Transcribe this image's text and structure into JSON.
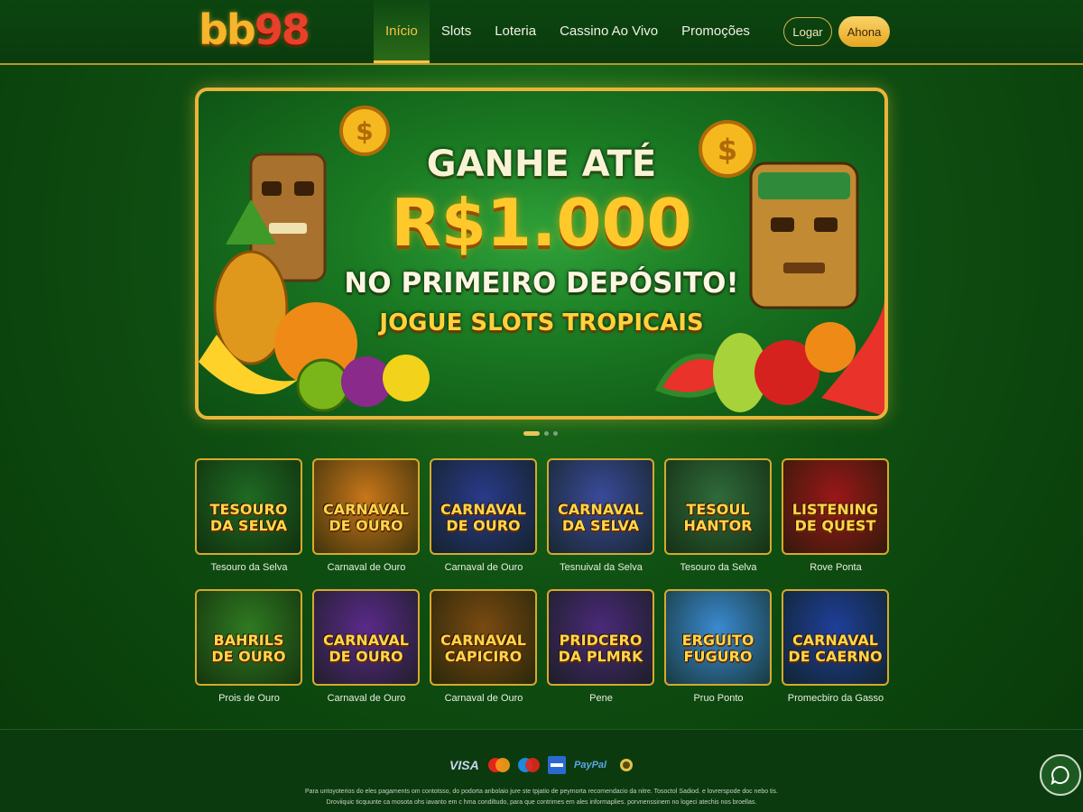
{
  "header": {
    "logo_left": "bb",
    "logo_right": "98",
    "nav": [
      "Início",
      "Slots",
      "Loteria",
      "Cassino Ao Vivo",
      "Promoções"
    ],
    "login_label": "Logar",
    "join_label": "Ahona"
  },
  "banner": {
    "line1": "GANHE ATÉ",
    "line2": "R$1.000",
    "line3": "NO PRIMEIRO DEPÓSITO!",
    "line4": "JOGUE SLOTS TROPICAIS",
    "active_slide": 1,
    "slide_count": 3
  },
  "games": [
    {
      "art": "TESOURO DA SELVA",
      "name": "Tesouro da Selva",
      "bg": "#1f6a24"
    },
    {
      "art": "CARNAVAL DE OURO",
      "name": "Carnaval de Ouro",
      "bg": "#c8761a"
    },
    {
      "art": "CARNAVAL DE OURO",
      "name": "Carnaval de Ouro",
      "bg": "#2a3a8a"
    },
    {
      "art": "CARNAVAL DA SELVA",
      "name": "Tesnuival da Selva",
      "bg": "#3a4a9a"
    },
    {
      "art": "TESOUL HANTOR",
      "name": "Tesouro da Selva",
      "bg": "#2f6a3a"
    },
    {
      "art": "LISTENING DE QUEST",
      "name": "Rove Ponta",
      "bg": "#9a1818"
    },
    {
      "art": "BAHRILS DE OURO",
      "name": "Prois de Ouro",
      "bg": "#2f7a22"
    },
    {
      "art": "CARNAVAL DE OURO",
      "name": "Carnaval de Ouro",
      "bg": "#5a2a8a"
    },
    {
      "art": "CARNAVAL CAPICIRO",
      "name": "Carnaval de Ouro",
      "bg": "#7a4a12"
    },
    {
      "art": "PRIDCERO DA PLMRK",
      "name": "Pene",
      "bg": "#4a2a7a"
    },
    {
      "art": "ERGUITO FUGURO",
      "name": "Pruo Ponto",
      "bg": "#3a8ad0"
    },
    {
      "art": "CARNAVAL DE CAERNO",
      "name": "Promecbiro da Gasso",
      "bg": "#1f3f9a"
    }
  ],
  "footer": {
    "payments": [
      "VISA",
      "mastercard",
      "maestro",
      "amex",
      "PayPal",
      "+18"
    ],
    "legal_line1": "Para untoyoterios do eles pagaments om contotsso, do podorta anbolaio jure ste tpjatio de peymorta recomendacio da nitre. Tosoctol Sadiod. e lovrerspode doc nebo tis.",
    "legal_line2": "Droviiquic ticquunte ca mosota ohs iavanto em c hma condiltudo, para que contrimes em ales informaplies. porvnenssinem no logeci atechis nos broellas."
  },
  "colors": {
    "accent": "#f5c445",
    "bg": "#0f4f12",
    "border": "#e9b53a"
  }
}
